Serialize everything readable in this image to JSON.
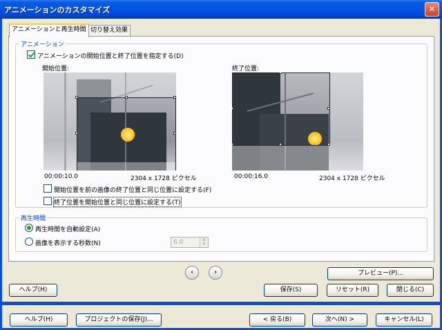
{
  "window": {
    "title": "アニメーションのカスタマイズ",
    "close_glyph": "✕"
  },
  "tabs": [
    {
      "label": "アニメーションと再生時間",
      "active": true
    },
    {
      "label": "切り替え効果",
      "active": false
    }
  ],
  "animation_group": {
    "label": "アニメーション",
    "specify_checkbox": {
      "label": "アニメーションの開始位置と終了位置を指定する(D)",
      "checked": true
    },
    "start": {
      "label": "開始位置:",
      "time": "00:00:10.0",
      "size": "2304 x 1728 ピクセル"
    },
    "end": {
      "label": "終了位置:",
      "time": "00:00:16.0",
      "size": "2304 x 1728 ピクセル"
    },
    "option_prev": {
      "label": "開始位置を前の画像の終了位置と同じ位置に設定する(F)",
      "checked": false
    },
    "option_same": {
      "label": "終了位置を開始位置と同じ位置に設定する(T)",
      "checked": false
    }
  },
  "duration_group": {
    "label": "再生時間",
    "auto": {
      "label": "再生時間を自動設定(A)",
      "selected": true
    },
    "seconds": {
      "label": "画像を表示する秒数(N)",
      "selected": false,
      "value": "6.0"
    }
  },
  "panel_buttons": {
    "prev_glyph": "‹",
    "next_glyph": "›",
    "preview": "プレビュー(P)...",
    "help": "ヘルプ(H)",
    "save": "保存(S)",
    "reset": "リセット(R)",
    "close": "閉じる(C)"
  },
  "wizard_buttons": {
    "help": "ヘルプ(H)",
    "save_project": "プロジェクトの保存(J)...",
    "back": "< 戻る(B)",
    "next": "次へ(N) >",
    "cancel": "キャンセル(L)"
  },
  "colors": {
    "title_bar": "#0055E5",
    "group_label": "#0046D5",
    "check": "#21A121"
  }
}
